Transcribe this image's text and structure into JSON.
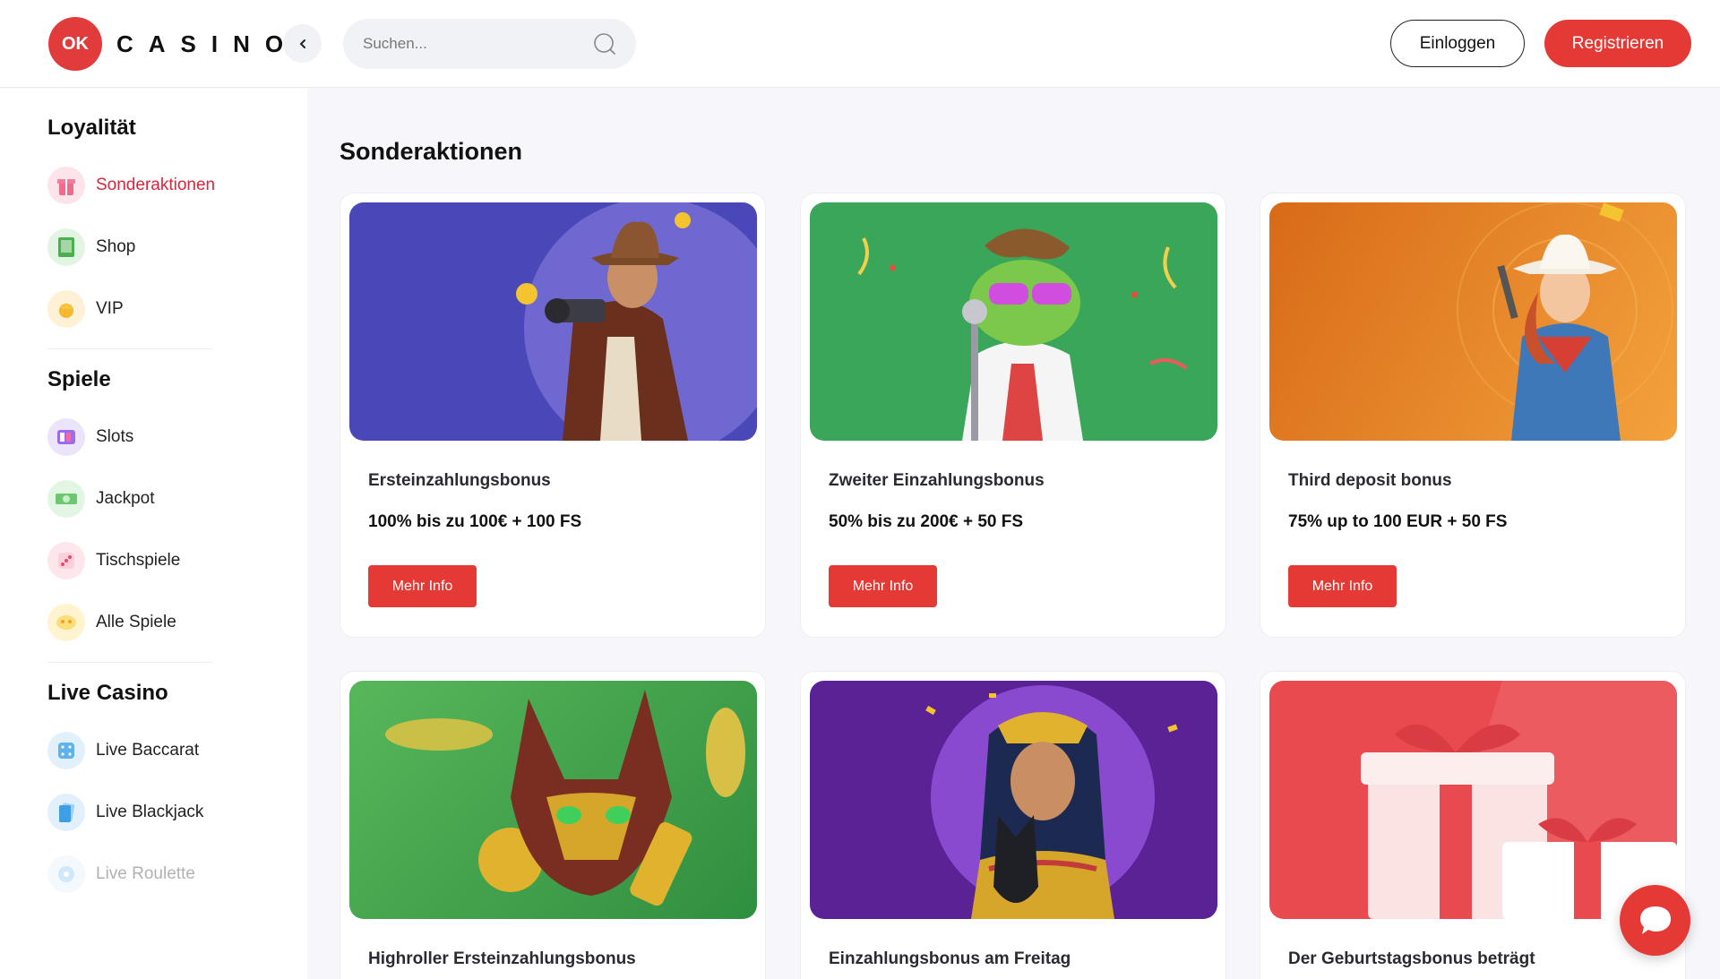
{
  "header": {
    "logo_mark": "OK",
    "brand": "CASINO",
    "collapse_icon": "chevron-left-icon",
    "search_placeholder": "Suchen...",
    "login_label": "Einloggen",
    "register_label": "Registrieren"
  },
  "sidebar": {
    "sections": [
      {
        "title": "Loyalität",
        "items": [
          {
            "label": "Sonderaktionen",
            "icon": "gift-icon",
            "active": true
          },
          {
            "label": "Shop",
            "icon": "shop-icon"
          },
          {
            "label": "VIP",
            "icon": "crown-icon"
          }
        ]
      },
      {
        "title": "Spiele",
        "items": [
          {
            "label": "Slots",
            "icon": "slots-icon"
          },
          {
            "label": "Jackpot",
            "icon": "jackpot-icon"
          },
          {
            "label": "Tischspiele",
            "icon": "dice-icon"
          },
          {
            "label": "Alle Spiele",
            "icon": "all-games-icon"
          }
        ]
      },
      {
        "title": "Live Casino",
        "items": [
          {
            "label": "Live Baccarat",
            "icon": "baccarat-icon"
          },
          {
            "label": "Live Blackjack",
            "icon": "cards-icon"
          },
          {
            "label": "Live Roulette",
            "icon": "roulette-icon"
          }
        ]
      }
    ]
  },
  "main": {
    "title": "Sonderaktionen",
    "cards": [
      {
        "title": "Ersteinzahlungsbonus",
        "offer": "100% bis zu 100€ + 100 FS",
        "button": "Mehr Info",
        "image": "cowboy-gunslinger",
        "color": "#4a47b8"
      },
      {
        "title": "Zweiter Einzahlungsbonus",
        "offer": "50% bis zu 200€ + 50 FS",
        "button": "Mehr Info",
        "image": "frog-singer",
        "color": "#3aa65a"
      },
      {
        "title": "Third deposit bonus",
        "offer": "75% up to 100 EUR + 50 FS",
        "button": "Mehr Info",
        "image": "cowgirl",
        "color": "#e8861e"
      },
      {
        "title": "Highroller Ersteinzahlungsbonus",
        "offer": "",
        "button": "",
        "image": "egyptian-cat",
        "color": "#3a9d4a"
      },
      {
        "title": "Einzahlungsbonus am Freitag",
        "offer": "",
        "button": "",
        "image": "cleopatra",
        "color": "#5b2296"
      },
      {
        "title": "Der Geburtstagsbonus beträgt",
        "offer": "",
        "button": "",
        "image": "gift-boxes",
        "color": "#e84a4f"
      }
    ]
  },
  "chat": {
    "icon": "chat-bubble-icon"
  }
}
